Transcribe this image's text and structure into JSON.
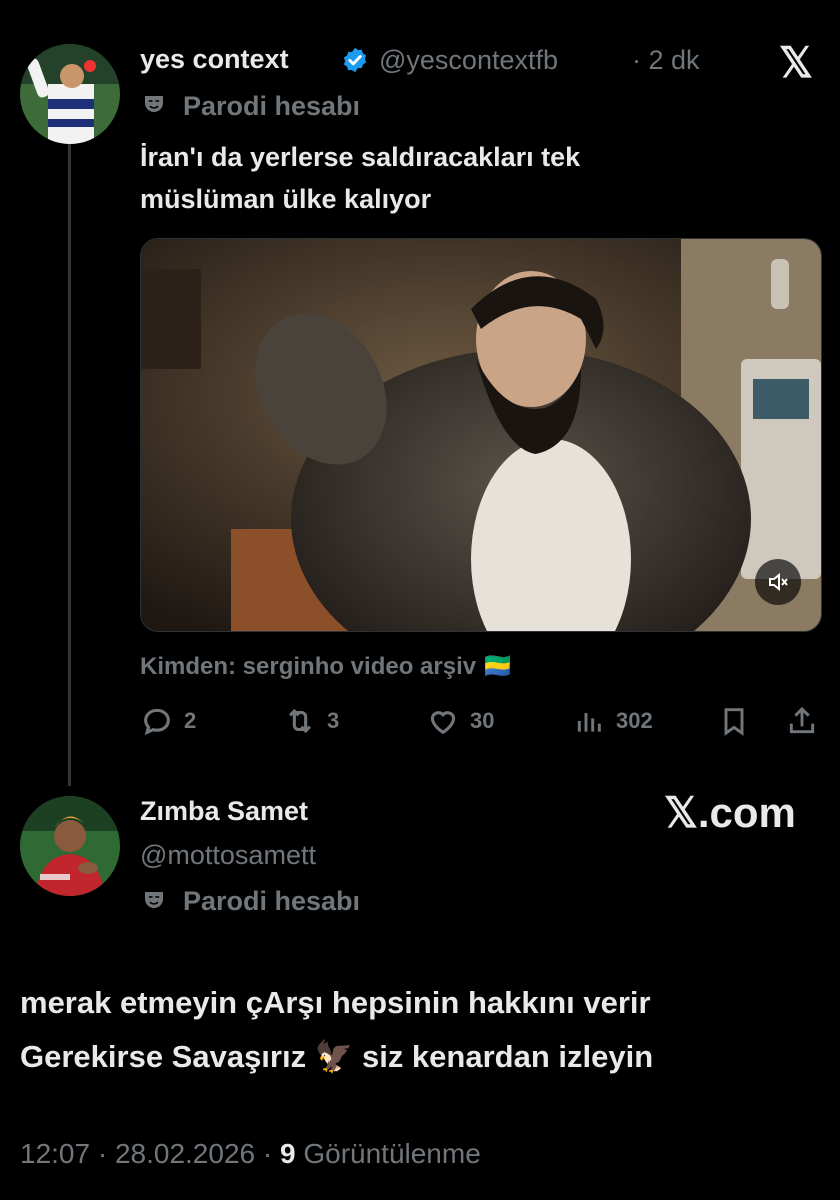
{
  "tweet": {
    "display_name": "yes context",
    "handle": "@yescontextfb",
    "time": "· 2 dk",
    "parody_label": "Parodi hesabı",
    "text_line1": "İran'ı da yerlerse saldıracakları tek",
    "text_line2": "müslüman ülke kalıyor",
    "source": "Kimden: serginho video arşiv",
    "source_flag": "🇬🇦",
    "stats": {
      "replies": "2",
      "reposts": "3",
      "likes": "30",
      "views": "302"
    }
  },
  "reply": {
    "display_name": "Zımba Samet",
    "handle": "@mottosamett",
    "parody_label": "Parodi hesabı",
    "line1": "merak etmeyin çArşı hepsinin hakkını verir",
    "line2_a": "Gerekirse Savaşırız",
    "line2_emoji": "🦅",
    "line2_b": "siz kenardan izleyin",
    "timestamp": "12:07 · 28.02.2026 · ",
    "view_count": "9",
    "view_label": " Görüntülenme"
  },
  "watermark": "𝕏.com",
  "x_logo": "𝕏",
  "colors": {
    "verified": "#1d9bf0",
    "muted": "#71767b",
    "text": "#e7e9ea",
    "background": "#000000"
  },
  "icons": [
    "x-logo-icon",
    "verified-icon",
    "parody-mask-icon",
    "mute-icon",
    "reply-icon",
    "repost-icon",
    "like-icon",
    "views-icon",
    "bookmark-icon",
    "share-icon",
    "eagle-icon"
  ]
}
